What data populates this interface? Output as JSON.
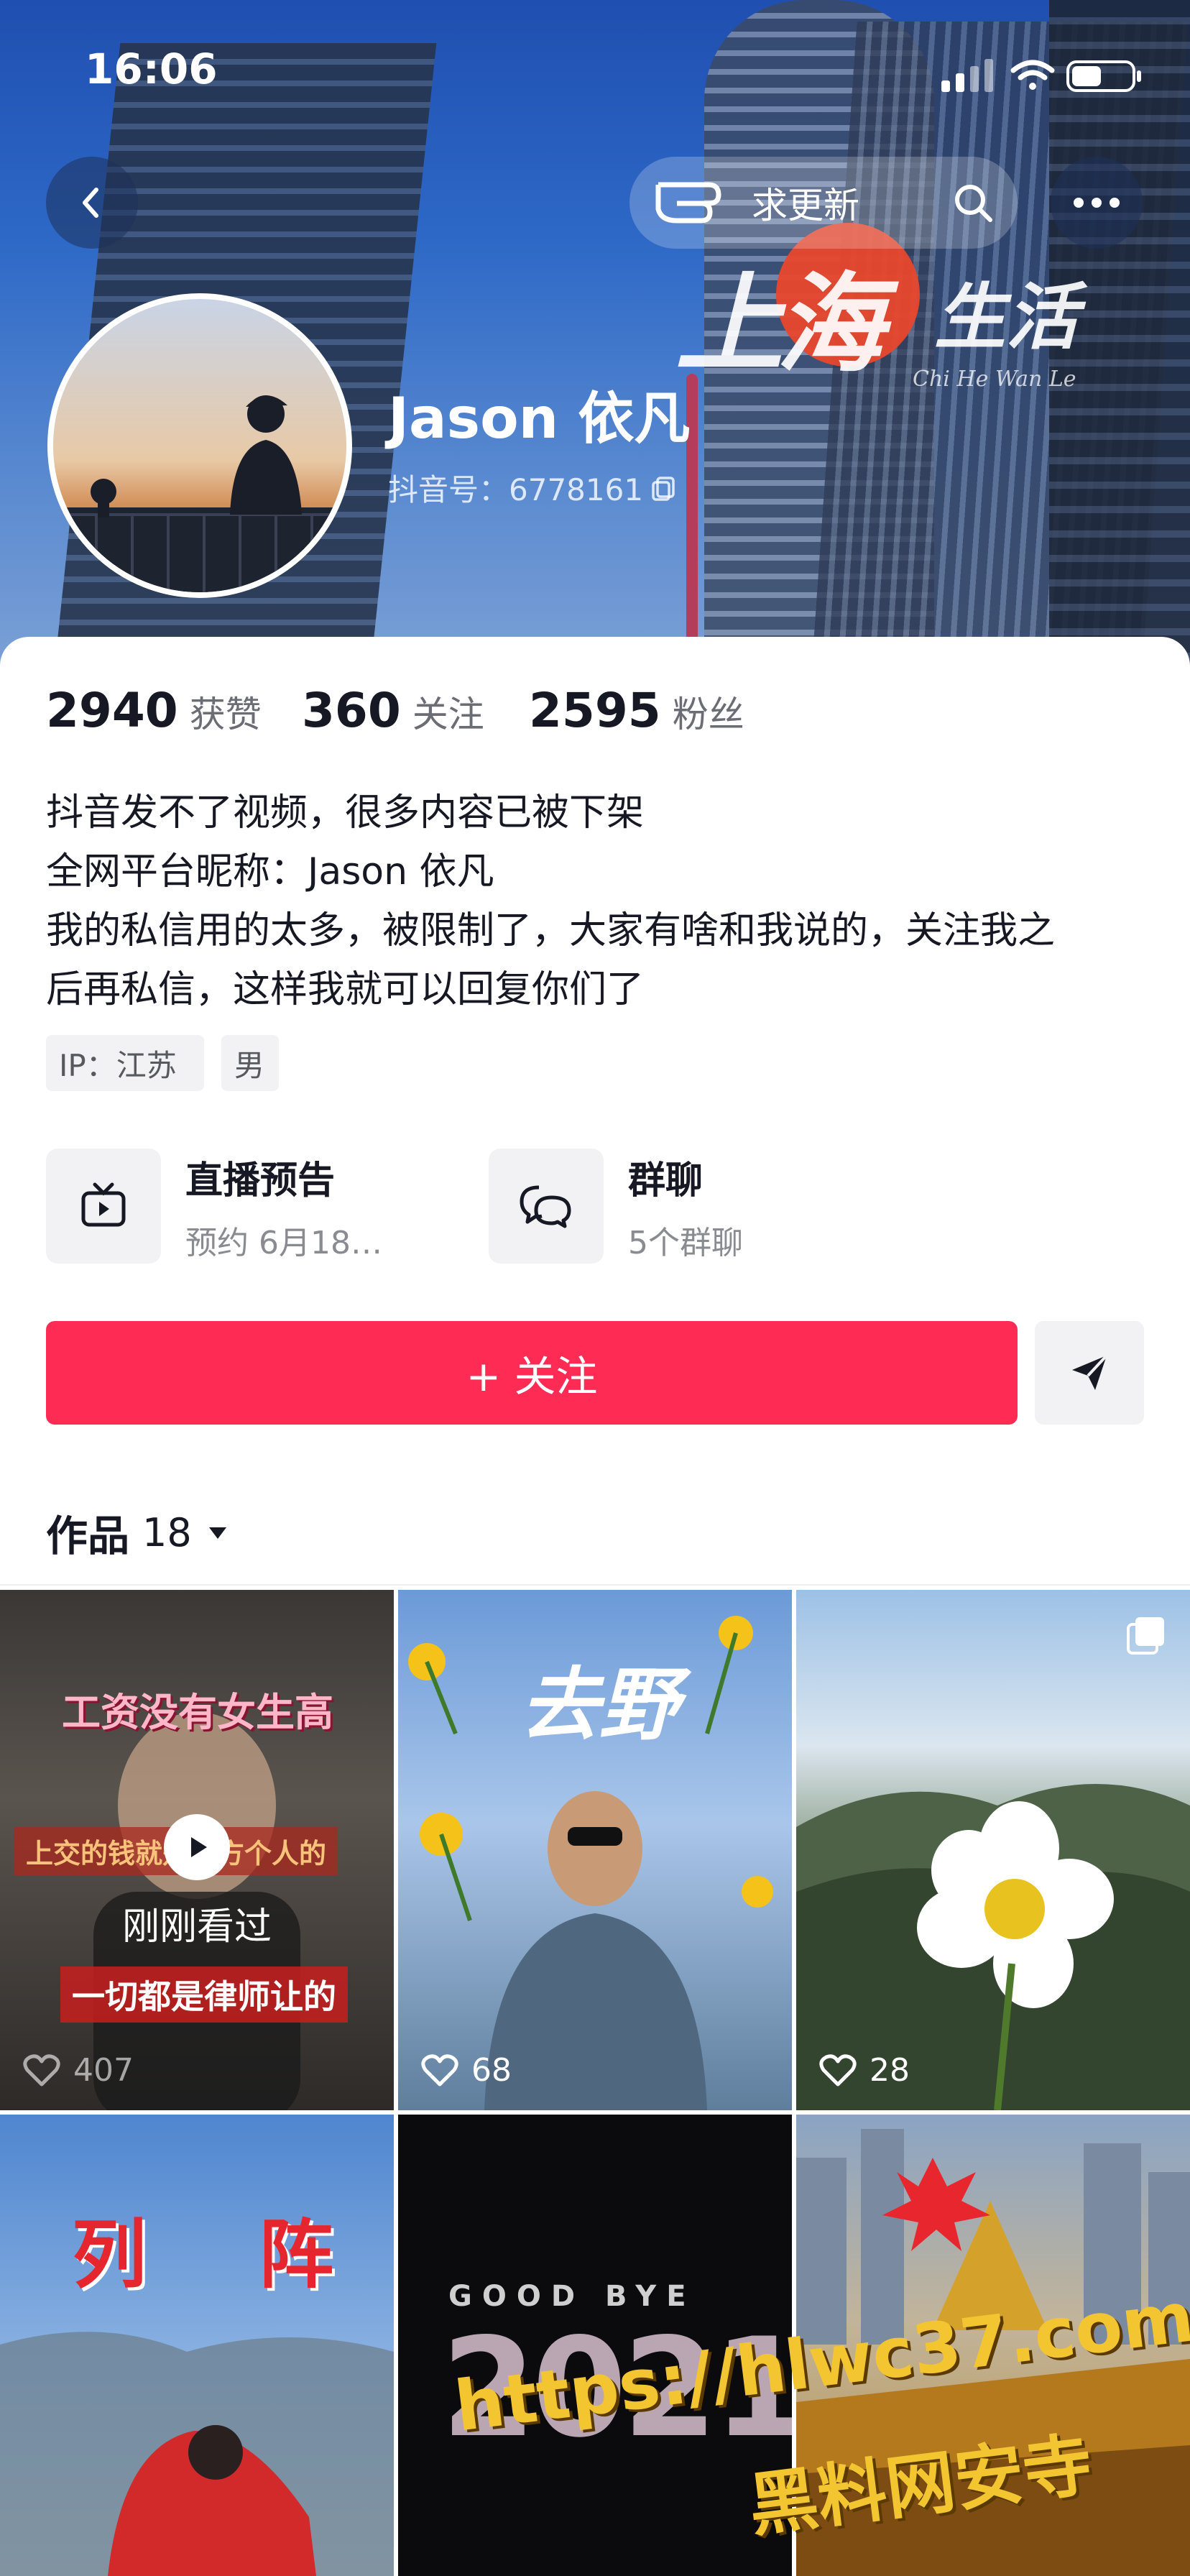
{
  "status_bar": {
    "time": "16:06"
  },
  "header": {
    "update_label": "求更新",
    "back_icon": "chevron-left-icon",
    "search_icon": "search-icon",
    "more_icon": "more-dots-icon",
    "cover_logo_main": "上海",
    "cover_logo_secondary": "生活",
    "cover_logo_sub": "Chi He Wan Le"
  },
  "profile": {
    "name": "Jason 依凡",
    "douyin_id": "抖音号：6778161"
  },
  "stats": [
    {
      "num": "2940",
      "label": "获赞"
    },
    {
      "num": "360",
      "label": "关注"
    },
    {
      "num": "2595",
      "label": "粉丝"
    }
  ],
  "bio": [
    "抖音发不了视频，很多内容已被下架",
    "全网平台昵称：Jason 依凡",
    "我的私信用的太多，被限制了，大家有啥和我说的，关注我之",
    "后再私信，这样我就可以回复你们了"
  ],
  "tags": [
    "IP：江苏",
    "男"
  ],
  "features": [
    {
      "title": "直播预告",
      "sub": "预约 6月18…",
      "icon": "tv-icon"
    },
    {
      "title": "群聊",
      "sub": "5个群聊",
      "icon": "chat-bubbles-icon"
    }
  ],
  "actions": {
    "follow_label": "+ 关注",
    "share_icon": "send-icon"
  },
  "works": {
    "label": "作品",
    "count": "18"
  },
  "grid": [
    {
      "likes": "407",
      "overlay": "刚刚看过",
      "caption_top": "工资没有女生高",
      "caption_mid": "上交的钱就是女方个人的",
      "caption_bottom": "一切都是律师让的"
    },
    {
      "likes": "68",
      "caption_top": "去野"
    },
    {
      "likes": "28"
    },
    {
      "caption_top": "列 阵"
    },
    {
      "caption_top": "GOOD BYE",
      "caption_mid": "2021"
    },
    {}
  ],
  "watermark": {
    "line1": "https://hlwc37.com",
    "line2": "黑料网安寺"
  },
  "colors": {
    "accent": "#fe2c55",
    "text_primary": "#161823",
    "text_secondary": "#8a8b91"
  }
}
